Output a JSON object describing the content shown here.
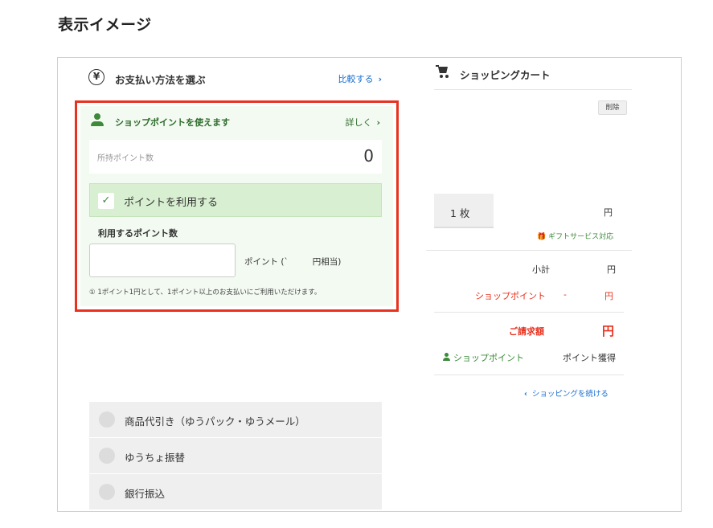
{
  "heading": "表示イメージ",
  "payment": {
    "icon_glyph": "¥",
    "title": "お支払い方法を選ぶ",
    "compare_link": "比較する",
    "chevron": "›",
    "shop_points": {
      "title": "ショップポイントを使えます",
      "detail_link": "詳しく",
      "owned_label": "所持ポイント数",
      "owned_value": "0",
      "use_check_glyph": "✓",
      "use_check_label": "ポイントを利用する",
      "use_points_label": "利用するポイント数",
      "points_input_value": "",
      "points_unit": "ポイント (`         円相当)",
      "note": "① 1ポイント1円として、1ポイント以上のお支払いにご利用いただけます。"
    },
    "methods": [
      {
        "label": "商品代引き（ゆうパック・ゆうメール）"
      },
      {
        "label": "ゆうちょ振替"
      },
      {
        "label": "銀行振込"
      }
    ]
  },
  "cart": {
    "title": "ショッピングカート",
    "delete_button": "削除",
    "quantity": "1 枚",
    "price": "円",
    "gift_link": "🎁 ギフトサービス対応",
    "subtotal_label": "小計",
    "subtotal_value": "円",
    "shop_point_label": "ショップポイント",
    "shop_point_dash": "-",
    "shop_point_value": "円",
    "total_label": "ご請求額",
    "total_value": "円",
    "earn_label": "ショップポイント",
    "earn_value": "ポイント獲得",
    "continue_link": "ショッピングを続ける",
    "back_chevron": "‹"
  },
  "colors": {
    "accent_red": "#e8321f",
    "accent_green": "#3c8a3a",
    "link_blue": "#1a6fd1"
  }
}
